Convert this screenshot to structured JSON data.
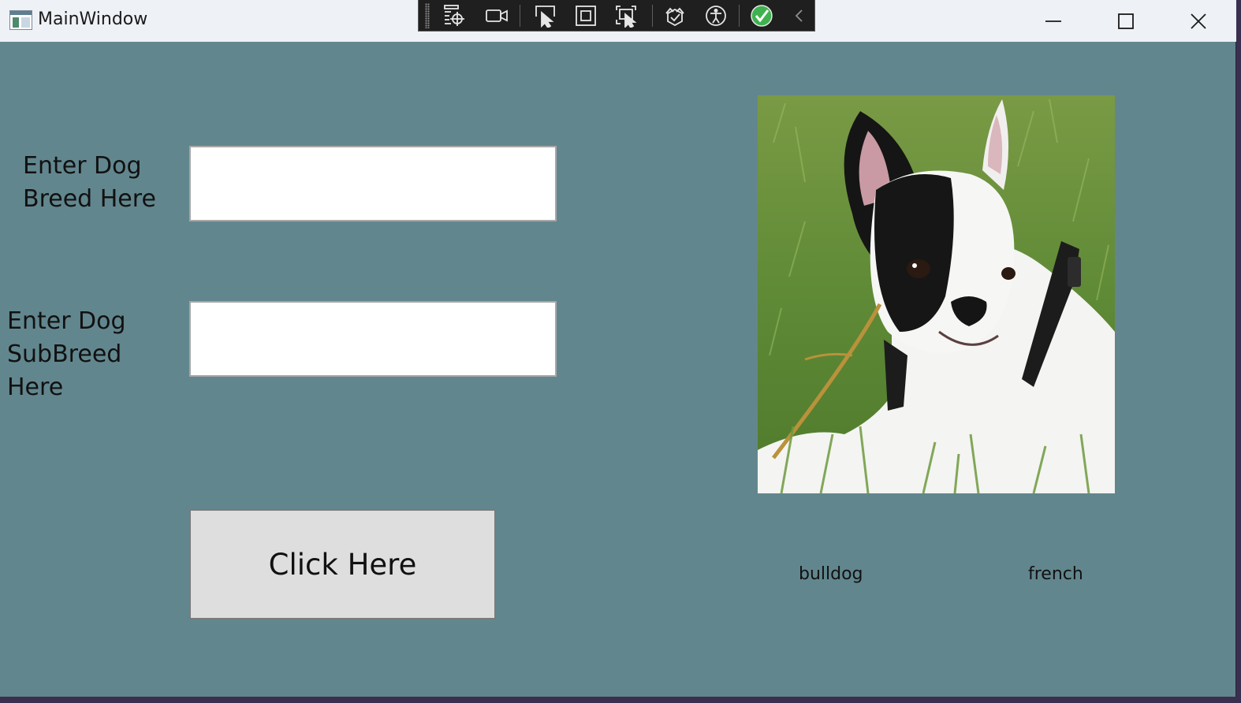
{
  "window": {
    "title": "MainWindow"
  },
  "toolbar": {
    "icons": [
      "go-to-live-visual-tree-icon",
      "record-icon",
      "select-element-icon",
      "display-layout-adorners-icon",
      "track-focused-element-icon",
      "binding-failures-icon",
      "accessibility-checker-icon",
      "in-app-toolbar-ok-icon",
      "collapse-toolbar-icon"
    ],
    "status_color": "#3fb24f"
  },
  "form": {
    "breed_label": "Enter Dog Breed Here",
    "breed_value": "",
    "subbreed_label": "Enter Dog SubBreed Here",
    "subbreed_value": "",
    "button_label": "Click Here"
  },
  "result": {
    "breed": "bulldog",
    "subbreed": "french",
    "image_subject": "black-and-white French bulldog puppy lying in grass"
  },
  "colors": {
    "background": "#62868e",
    "titlebar": "#eef1f6",
    "button": "#dedede"
  }
}
